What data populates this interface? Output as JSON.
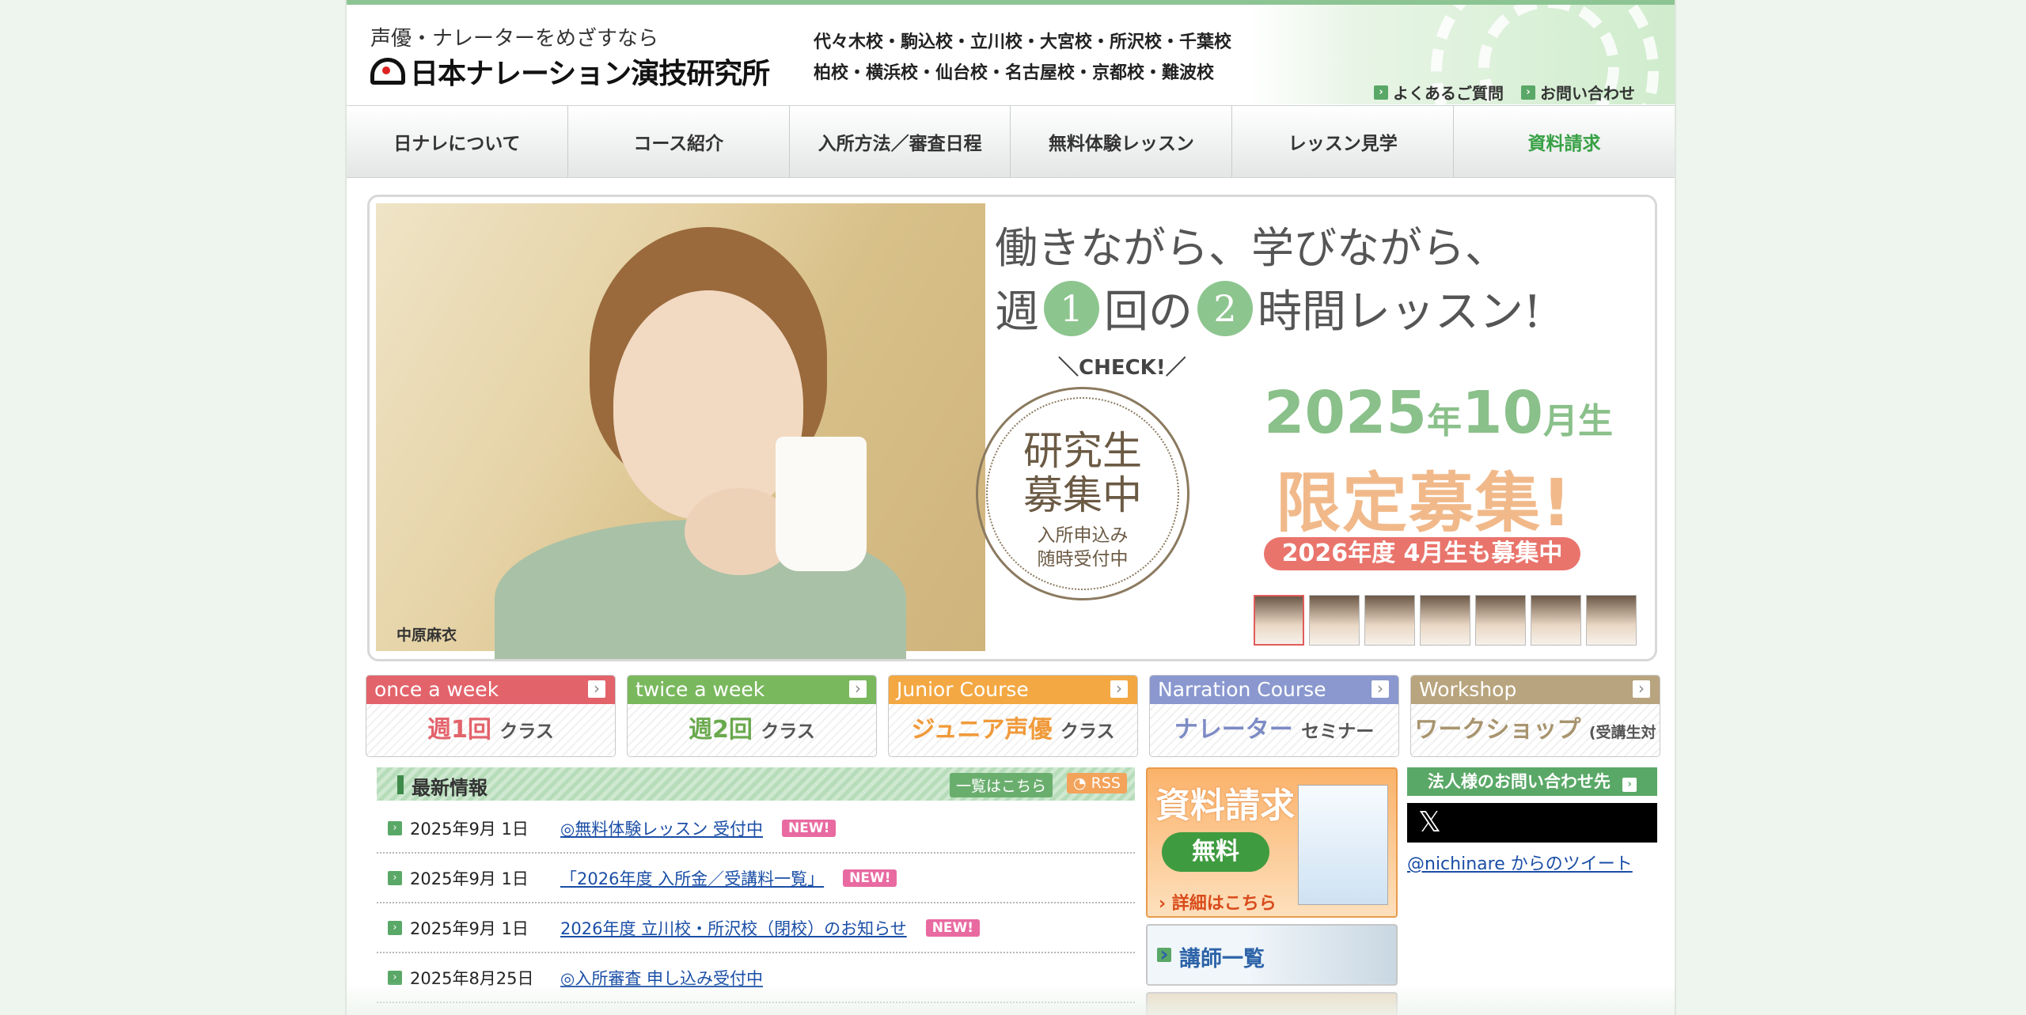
{
  "header": {
    "tagline": "声優・ナレーターをめざすなら",
    "logo_text": "日本ナレーション演技研究所",
    "schools_line1": "代々木校・駒込校・立川校・大宮校・所沢校・千葉校",
    "schools_line2": "柏校・横浜校・仙台校・名古屋校・京都校・難波校",
    "faq_link": "よくあるご質問",
    "contact_link": "お問い合わせ"
  },
  "nav": [
    "日ナレについて",
    "コース紹介",
    "入所方法／審査日程",
    "無料体験レッスン",
    "レッスン見学",
    "資料請求"
  ],
  "hero": {
    "line1": "働きながら、学びながら、",
    "line2_a": "週",
    "line2_num1": "1",
    "line2_b": "回の",
    "line2_num2": "2",
    "line2_c": "時間レッスン!",
    "check": "＼CHECK!／",
    "seal_big": "研究生募集中",
    "seal_small": "入所申込み随時受付中",
    "year": "2025",
    "year_unit": "年",
    "month": "10",
    "month_unit": "月生",
    "limited": "限定募集!",
    "badge": "2026年度 4月生も募集中",
    "credit": "中原麻衣"
  },
  "courses": [
    {
      "en": "once a week",
      "jp_main": "週1回",
      "jp_sub": "クラス",
      "color": "#e3636b",
      "text_color": "#e3636b"
    },
    {
      "en": "twice a week",
      "jp_main": "週2回",
      "jp_sub": "クラス",
      "color": "#7ab85e",
      "text_color": "#6aa94d"
    },
    {
      "en": "Junior Course",
      "jp_main": "ジュニア声優",
      "jp_sub": "クラス",
      "color": "#f3a843",
      "text_color": "#f09a3a"
    },
    {
      "en": "Narration Course",
      "jp_main": "ナレーター",
      "jp_sub": "セミナー",
      "color": "#8a98cf",
      "text_color": "#7d8bc4"
    },
    {
      "en": "Workshop",
      "jp_main": "ワークショップ",
      "jp_sub": "(受講生対象)",
      "color": "#b8a47e",
      "text_color": "#a8946e"
    }
  ],
  "news": {
    "title": "最新情報",
    "list_button": "一覧はこちら",
    "rss_button": "RSS",
    "new_label": "NEW!",
    "items": [
      {
        "date": "2025年9月 1日",
        "title": "◎無料体験レッスン 受付中"
      },
      {
        "date": "2025年9月 1日",
        "title": "「2026年度 入所金／受講料一覧」"
      },
      {
        "date": "2025年9月 1日",
        "title": "2026年度 立川校・所沢校（閉校）のお知らせ"
      },
      {
        "date": "2025年8月25日",
        "title": "◎入所審査 申し込み受付中"
      }
    ]
  },
  "sidebar": {
    "request_title": "資料請求",
    "request_free": "無料",
    "request_more": "詳細はこちら",
    "teachers": "講師一覧",
    "corp_contact": "法人様のお問い合わせ先",
    "x_logo": "𝕏",
    "tweets_link": "@nichinare からのツイート"
  }
}
